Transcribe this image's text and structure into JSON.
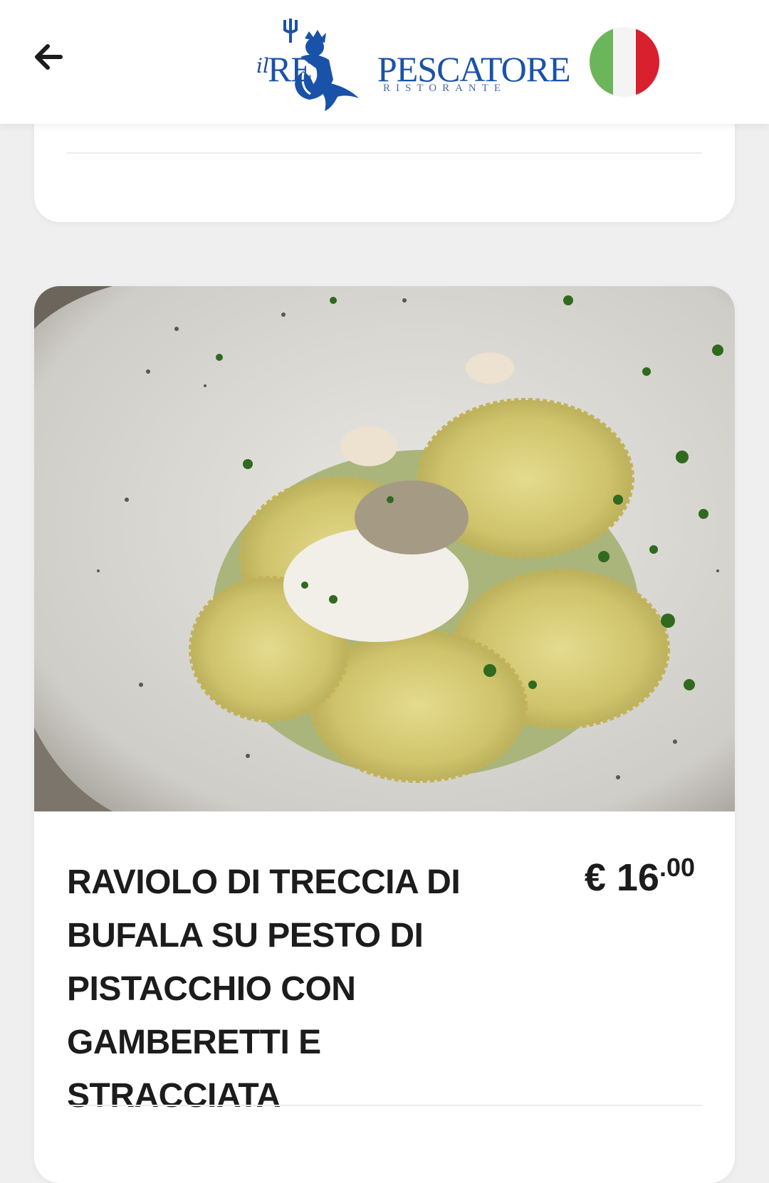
{
  "header": {
    "back_label": "back",
    "logo": {
      "prefix": "il",
      "name": "REPESCATORE",
      "subtitle": "RISTORANTE"
    },
    "language_flag": "italian-flag"
  },
  "colors": {
    "brand_blue": "#1a52a8",
    "flag_green": "#6bb55a",
    "flag_white": "#f4f4f4",
    "flag_red": "#d8202f"
  },
  "item": {
    "name": "RAVIOLO DI TRECCIA DI BUFALA SU PESTO DI PISTACCHIO CON GAMBERETTI E STRACCIATA",
    "price_currency": "€",
    "price_main": "16",
    "price_cents": ".00",
    "image": "ravioli-dish-photo"
  }
}
